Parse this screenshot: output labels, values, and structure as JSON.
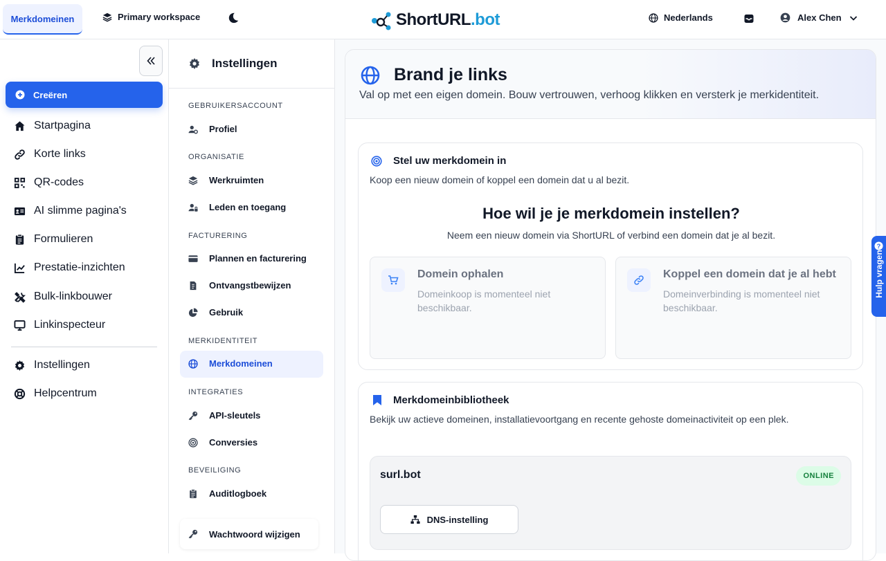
{
  "topbar": {
    "active_tab": "Merkdomeinen",
    "workspace": "Primary workspace",
    "logo_main": "ShortURL",
    "logo_suffix": ".bot",
    "language": "Nederlands",
    "user": "Alex Chen"
  },
  "sidebar": {
    "create": "Creëren",
    "items": [
      {
        "label": "Startpagina",
        "icon": "home-icon"
      },
      {
        "label": "Korte links",
        "icon": "link-icon"
      },
      {
        "label": "QR-codes",
        "icon": "qr-icon"
      },
      {
        "label": "AI slimme pagina's",
        "icon": "id-card-icon"
      },
      {
        "label": "Formulieren",
        "icon": "clipboard-icon"
      },
      {
        "label": "Prestatie-inzichten",
        "icon": "chart-line-icon"
      },
      {
        "label": "Bulk-linkbouwer",
        "icon": "tools-icon"
      },
      {
        "label": "Linkinspecteur",
        "icon": "monitor-icon"
      }
    ],
    "bottom": [
      {
        "label": "Instellingen",
        "icon": "gear-icon"
      },
      {
        "label": "Helpcentrum",
        "icon": "lifebuoy-icon"
      }
    ]
  },
  "settings": {
    "title": "Instellingen",
    "sections": [
      {
        "title": "GEBRUIKERSACCOUNT",
        "items": [
          "Profiel"
        ]
      },
      {
        "title": "ORGANISATIE",
        "items": [
          "Werkruimten",
          "Leden en toegang"
        ]
      },
      {
        "title": "FACTURERING",
        "items": [
          "Plannen en facturering",
          "Ontvangstbewijzen",
          "Gebruik"
        ]
      },
      {
        "title": "MERKIDENTITEIT",
        "items": [
          "Merkdomeinen"
        ]
      },
      {
        "title": "INTEGRATIES",
        "items": [
          "API-sleutels",
          "Conversies"
        ]
      },
      {
        "title": "BEVEILIGING",
        "items": [
          "Auditlogboek"
        ]
      }
    ],
    "password": "Wachtwoord wijzigen"
  },
  "main": {
    "title": "Brand je links",
    "subtitle": "Val op met een eigen domein. Bouw vertrouwen, verhoog klikken en versterk je merkidentiteit.",
    "setup": {
      "title": "Stel uw merkdomein in",
      "subtitle": "Koop een nieuw domein of koppel een domein dat u al bezit.",
      "question": "Hoe wil je je merkdomein instellen?",
      "question_sub": "Neem een nieuw domein via ShortURL of verbind een domein dat je al bezit.",
      "options": [
        {
          "title": "Domein ophalen",
          "desc": "Domeinkoop is momenteel niet beschikbaar."
        },
        {
          "title": "Koppel een domein dat je al hebt",
          "desc": "Domeinverbinding is momenteel niet beschikbaar."
        }
      ]
    },
    "library": {
      "title": "Merkdomeinbibliotheek",
      "subtitle": "Bekijk uw actieve domeinen, installatievoortgang en recente gehoste domeinactiviteit op een plek.",
      "domain": "surl.bot",
      "status": "ONLINE",
      "dns_button": "DNS-instelling"
    }
  },
  "help": "Hulp vragen",
  "colors": {
    "accent": "#2563eb",
    "logo_suffix": "#1e9bd7",
    "online": "#15803d"
  }
}
